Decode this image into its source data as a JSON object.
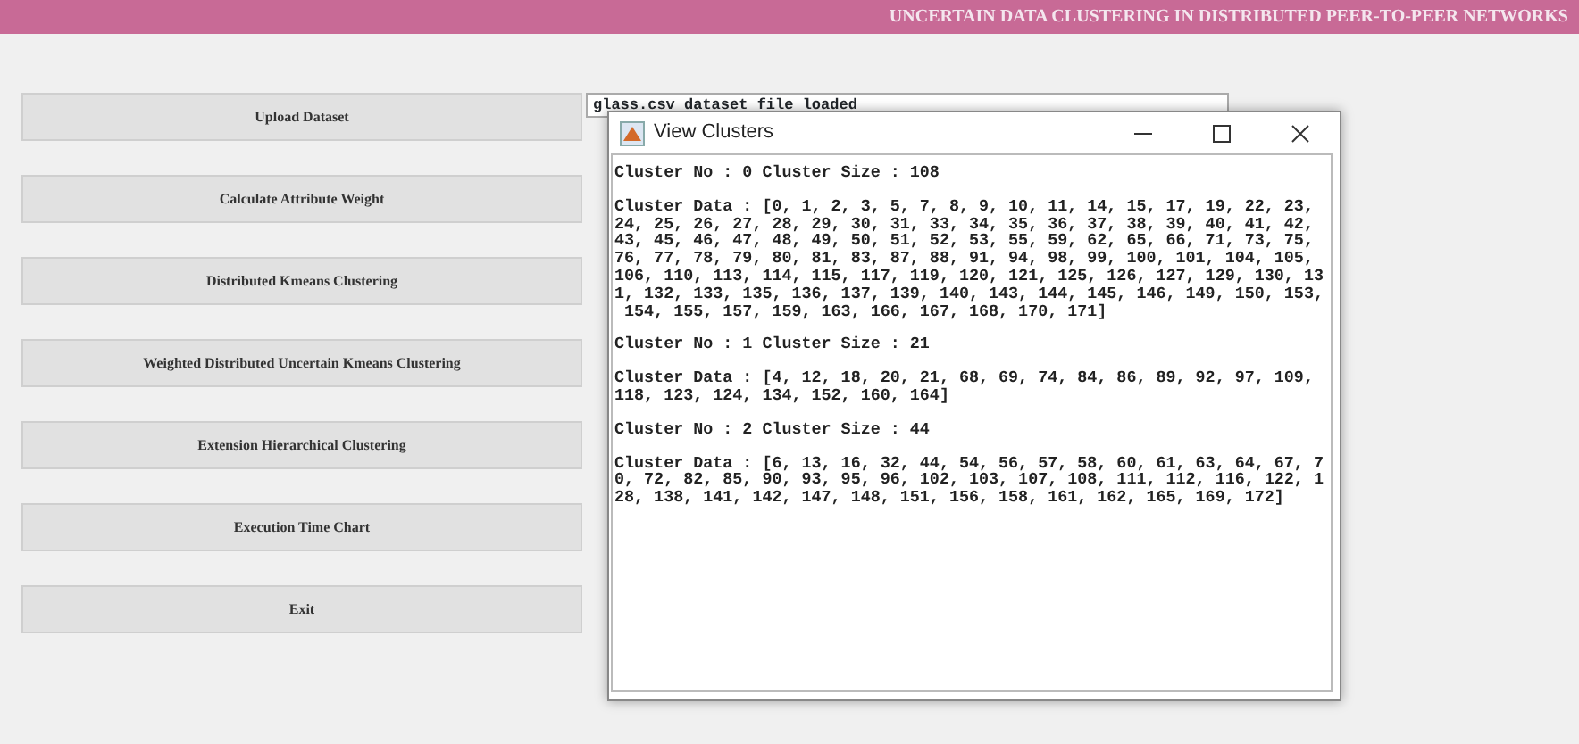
{
  "header": {
    "title": "UNCERTAIN DATA CLUSTERING IN DISTRIBUTED PEER-TO-PEER NETWORKS"
  },
  "buttons": [
    "Upload Dataset",
    "Calculate Attribute Weight",
    "Distributed Kmeans Clustering",
    "Weighted Distributed Uncertain Kmeans Clustering",
    "Extension Hierarchical Clustering",
    "Execution Time Chart",
    "Exit"
  ],
  "output": {
    "text": "glass.csv dataset file loaded"
  },
  "dialog": {
    "title": "View Clusters",
    "clusters": [
      {
        "header": "Cluster No : 0 Cluster Size : 108",
        "data": "Cluster Data : [0, 1, 2, 3, 5, 7, 8, 9, 10, 11, 14, 15, 17, 19, 22, 23,\n24, 25, 26, 27, 28, 29, 30, 31, 33, 34, 35, 36, 37, 38, 39, 40, 41, 42,\n43, 45, 46, 47, 48, 49, 50, 51, 52, 53, 55, 59, 62, 65, 66, 71, 73, 75,\n76, 77, 78, 79, 80, 81, 83, 87, 88, 91, 94, 98, 99, 100, 101, 104, 105,\n106, 110, 113, 114, 115, 117, 119, 120, 121, 125, 126, 127, 129, 130, 13\n1, 132, 133, 135, 136, 137, 139, 140, 143, 144, 145, 146, 149, 150, 153,\n 154, 155, 157, 159, 163, 166, 167, 168, 170, 171]"
      },
      {
        "header": "Cluster No : 1 Cluster Size : 21",
        "data": "Cluster Data : [4, 12, 18, 20, 21, 68, 69, 74, 84, 86, 89, 92, 97, 109,\n118, 123, 124, 134, 152, 160, 164]"
      },
      {
        "header": "Cluster No : 2 Cluster Size : 44",
        "data": "Cluster Data : [6, 13, 16, 32, 44, 54, 56, 57, 58, 60, 61, 63, 64, 67, 7\n0, 72, 82, 85, 90, 93, 95, 96, 102, 103, 107, 108, 111, 112, 116, 122, 1\n28, 138, 141, 142, 147, 148, 151, 156, 158, 161, 162, 165, 169, 172]"
      }
    ]
  }
}
